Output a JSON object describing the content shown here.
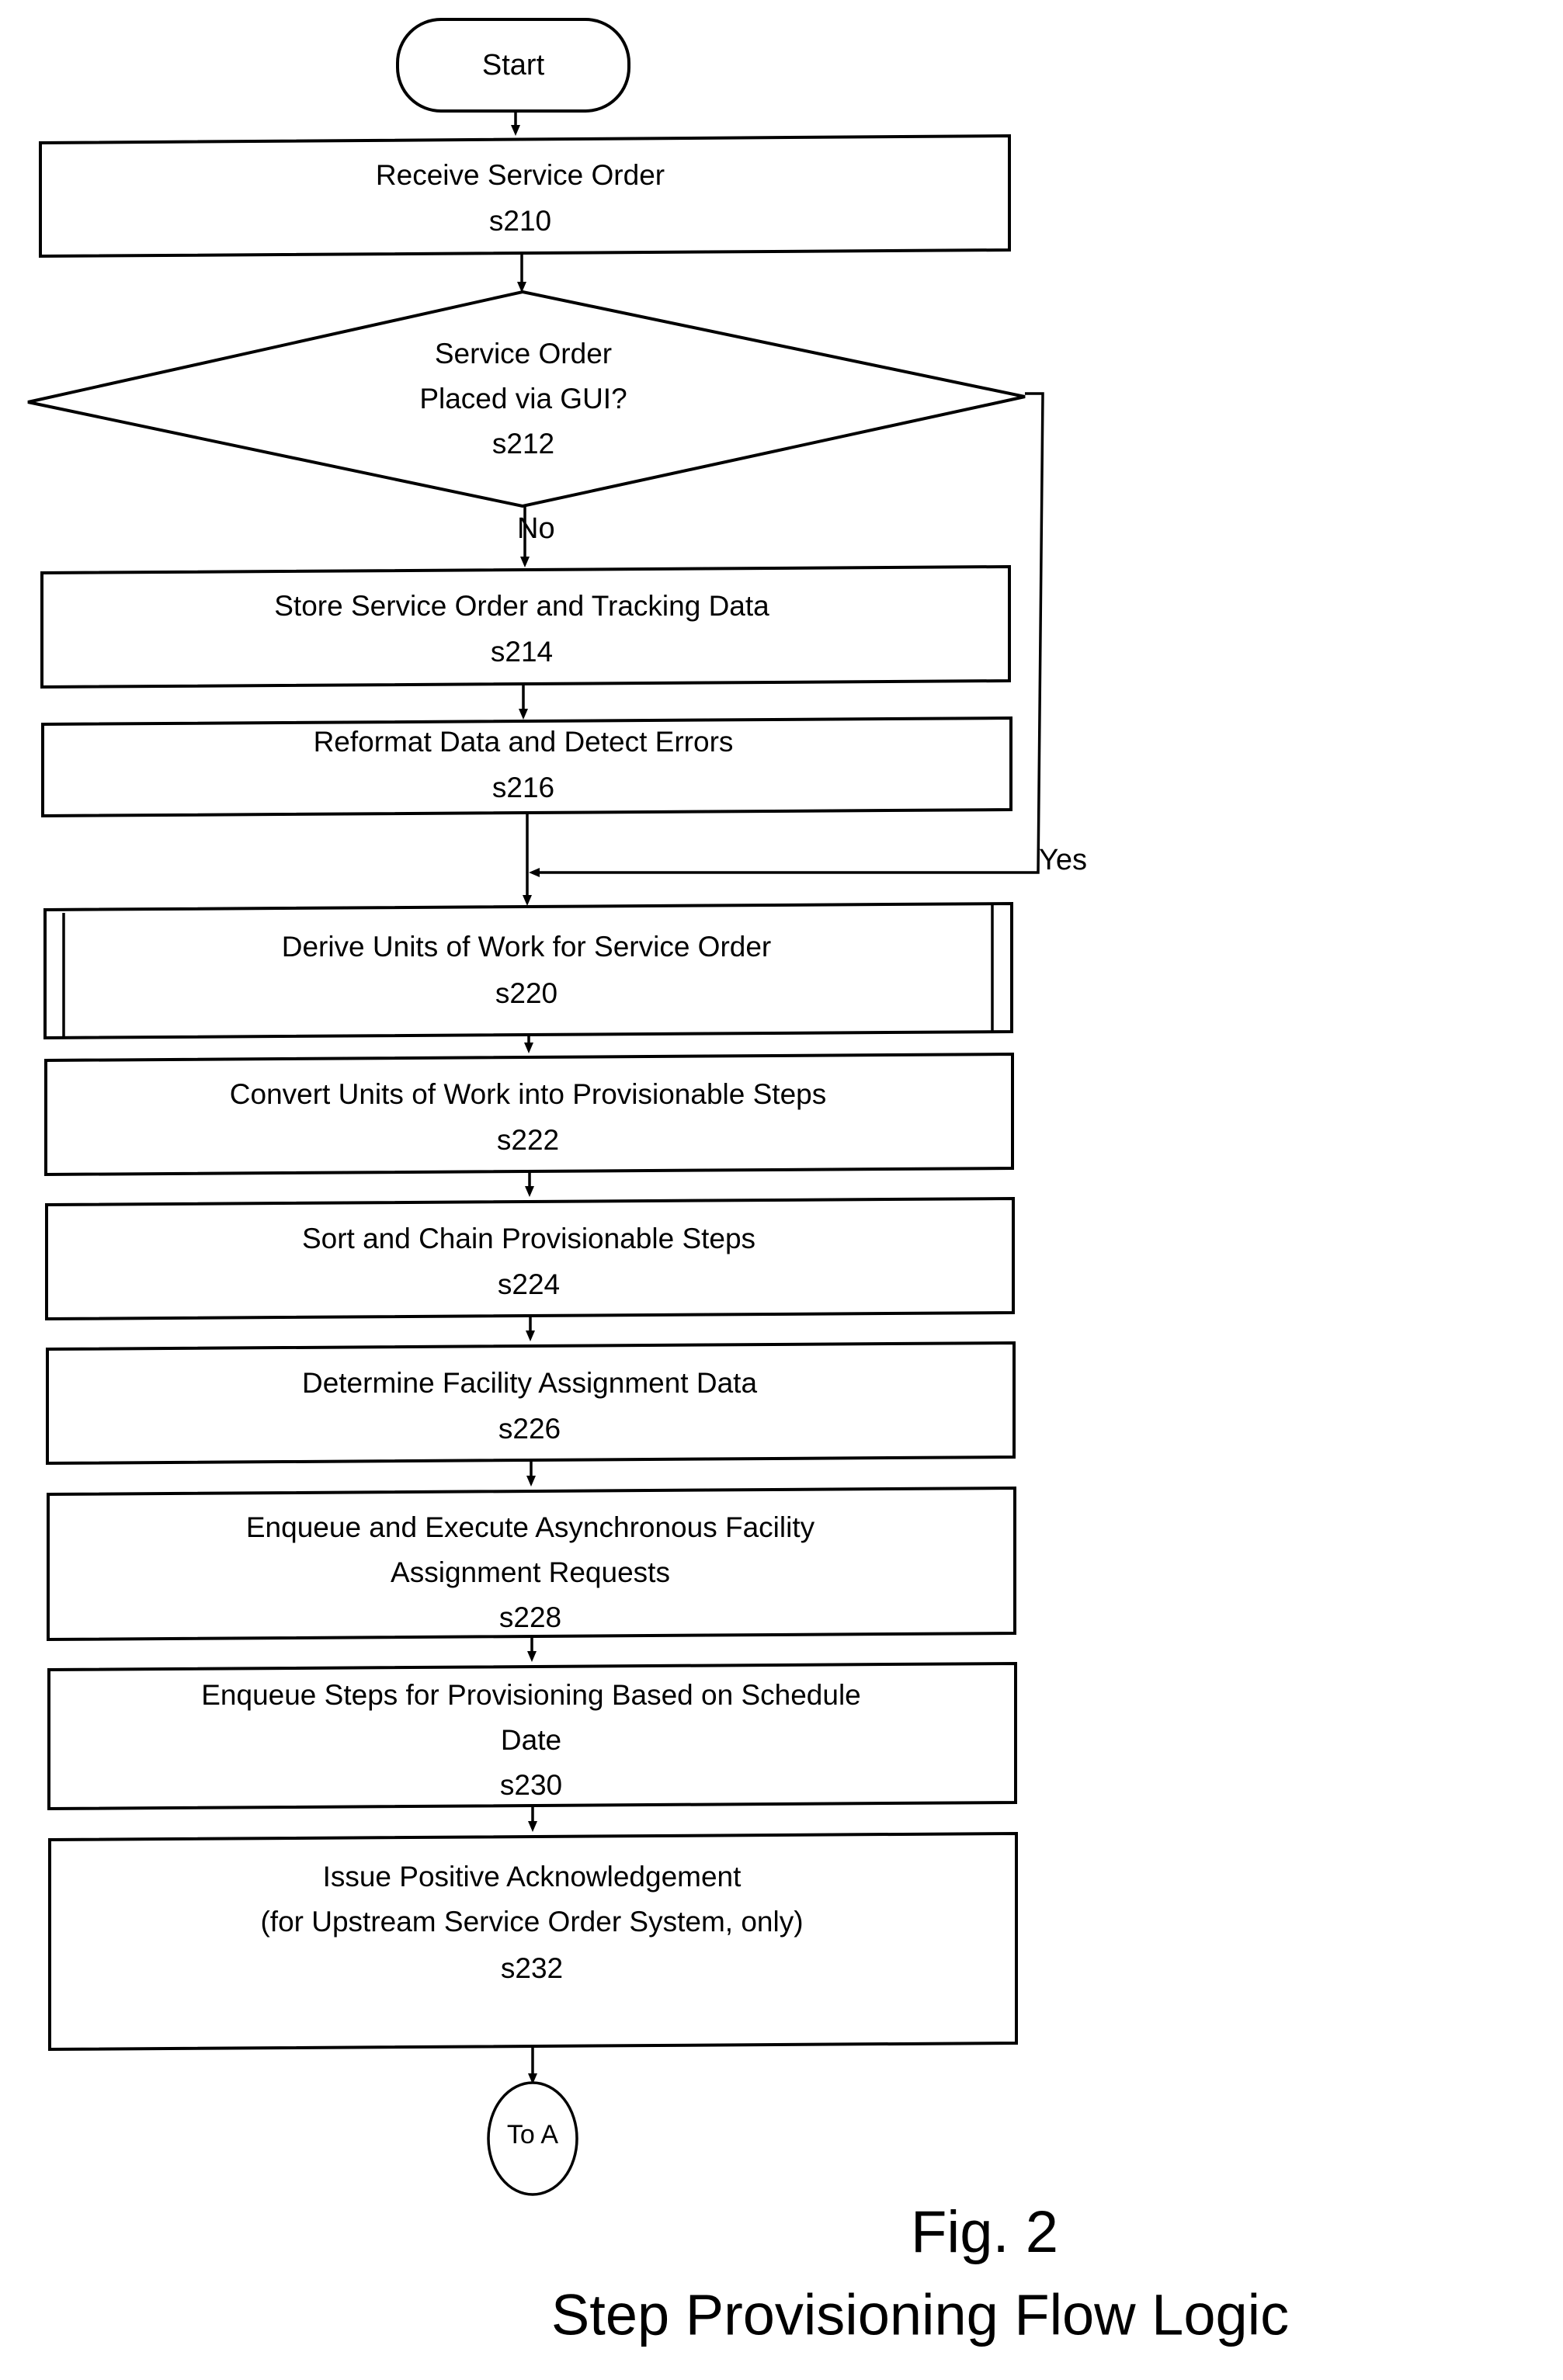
{
  "figure": {
    "number": "Fig. 2",
    "title": "Step Provisioning Flow Logic"
  },
  "diagram": {
    "type": "flowchart",
    "orientation": "top-to-bottom",
    "nodes": [
      {
        "id": "start",
        "shape": "terminator",
        "label": "Start",
        "step": ""
      },
      {
        "id": "s210",
        "shape": "process",
        "label": "Receive Service Order",
        "step": "s210"
      },
      {
        "id": "s212",
        "shape": "decision",
        "label_line1": "Service Order",
        "label_line2": "Placed via GUI?",
        "step": "s212"
      },
      {
        "id": "s214",
        "shape": "process",
        "label": "Store Service Order and Tracking Data",
        "step": "s214"
      },
      {
        "id": "s216",
        "shape": "process",
        "label": "Reformat Data and Detect Errors",
        "step": "s216"
      },
      {
        "id": "s220",
        "shape": "predefined-process",
        "label": "Derive Units of Work for Service Order",
        "step": "s220"
      },
      {
        "id": "s222",
        "shape": "process",
        "label": "Convert Units of Work into Provisionable Steps",
        "step": "s222"
      },
      {
        "id": "s224",
        "shape": "process",
        "label": "Sort and Chain Provisionable Steps",
        "step": "s224"
      },
      {
        "id": "s226",
        "shape": "process",
        "label": "Determine Facility Assignment Data",
        "step": "s226"
      },
      {
        "id": "s228",
        "shape": "process",
        "label_line1": "Enqueue and Execute Asynchronous Facility",
        "label_line2": "Assignment Requests",
        "step": "s228"
      },
      {
        "id": "s230",
        "shape": "process",
        "label_line1": "Enqueue Steps for Provisioning Based on Schedule",
        "label_line2": "Date",
        "step": "s230"
      },
      {
        "id": "s232",
        "shape": "process",
        "label_line1": "Issue Positive Acknowledgement",
        "label_line2": "(for Upstream Service Order System, only)",
        "step": "s232"
      },
      {
        "id": "to_a",
        "shape": "connector",
        "label": "To A",
        "step": ""
      }
    ],
    "branch_labels": {
      "no": "No",
      "yes": "Yes"
    }
  }
}
